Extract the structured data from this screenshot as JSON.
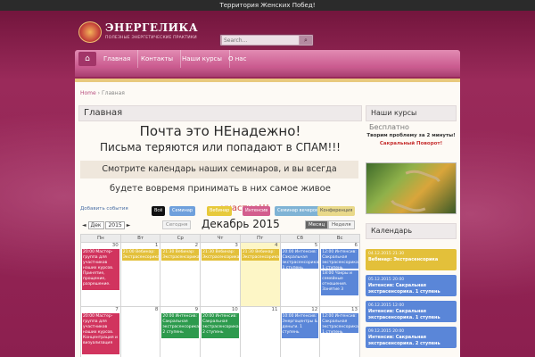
{
  "topbar": {
    "text": "Территория Женских Побед!"
  },
  "logo": {
    "title": "ЭНЕРГЕЛИКА",
    "subtitle": "ПОЛЕЗНЫЕ ЭНЕРГЕТИЧЕСКИЕ ПРАКТИКИ"
  },
  "search": {
    "placeholder": "Search..."
  },
  "nav": {
    "home_icon": "home-icon",
    "items": [
      "Главная",
      "Контакты",
      "Наши курсы",
      "О нас"
    ]
  },
  "breadcrumb": {
    "home": "Home",
    "current": "Главная"
  },
  "main": {
    "title": "Главная",
    "line1": "Почта это НЕнадежно!",
    "line2": "Письма теряются или попадают в СПАМ!!!",
    "promo1": "Смотрите календарь наших семинаров, и вы всегда",
    "promo2": "будете вовремя принимать в них самое живое",
    "promo3": "участие!!!"
  },
  "calendar": {
    "add_event": "Добавить события",
    "filters": [
      {
        "label": "Всё",
        "color": "#111111"
      },
      {
        "label": "Семинар",
        "color": "#6fa0dc"
      },
      {
        "label": "Вебинар",
        "color": "#e7c93a"
      },
      {
        "label": "Интенсив",
        "color": "#d35d8d"
      },
      {
        "label": "Семинар вечером",
        "color": "#7fb3d5"
      },
      {
        "label": "Конференция",
        "color": "#e9d98a"
      }
    ],
    "month_title": "Декабрь 2015",
    "prev": "◄",
    "next": "►",
    "month_select": "Дек",
    "year_select": "2015",
    "today": "Сегодня",
    "views": [
      "Месяц",
      "Неделя"
    ],
    "weekdays": [
      "Пн",
      "Вт",
      "Ср",
      "Чт",
      "Пт",
      "Сб",
      "Вс"
    ],
    "week1_days": [
      "30",
      "1",
      "2",
      "3",
      "4",
      "5",
      "6"
    ],
    "week2_days": [
      "7",
      "8",
      "9",
      "10",
      "11",
      "12",
      "13"
    ],
    "events": {
      "mon1": "20:00 Мастер-группа для участников наших курсов. Принятие, прощение, разрешение.",
      "tue1": "21:00 Вебинар: Экстрасенсорика",
      "wed1": "21:30 Вебинар: Экстрасенсорика",
      "thu1": "21:30 Вебинар: Экстрасенсорика",
      "fri1": "21:30 Вебинар: Экстрасенсорика",
      "sat1": "20:00 Интенсив: Сакральная экстрасенсорика. 1 ступень",
      "sun1a": "12:00 Интенсив: Сакральная экстрасенсорика. 1 ступень",
      "sun1b": "18:00 Чакры и семейные отношения. Занятие 3",
      "mon2": "20:00 Мастер-группа для участников наших курсов. Концентрация и визуализация",
      "wed2": "20:00 Интенсив: Сакральная экстрасенсорика. 2 ступень",
      "thu2": "20:00 Интенсив: Сакральная экстрасенсорика. 2 ступень",
      "sat2": "10:00 Интенсив: Энергоцентры & деньги. 1 ступень",
      "sun2": "12:00 Интенсив: Сакральная экстрасенсорика. 1 ступень"
    }
  },
  "sidebar": {
    "courses_title": "Наши курсы",
    "behind_text": "Бесплатно",
    "course_line1": "Творим проблему за 2 минуты!",
    "course_line2": "Сакральный Поворот!",
    "calendar_title": "Календарь",
    "events": [
      {
        "date": "04.12.2015 21:30",
        "name": "Вебинар: Экстрасенсорика",
        "color": "#e3c03a"
      },
      {
        "date": "05.12.2015 20:00",
        "name": "Интенсив: Сакральная экстрасенсорика. 1 ступень",
        "color": "#5a86d8"
      },
      {
        "date": "06.12.2015 12:00",
        "name": "Интенсив: Сакральная экстрасенсорика. 1 ступень",
        "color": "#5a86d8"
      },
      {
        "date": "09.12.2015 20:00",
        "name": "Интенсив: Сакральная экстрасенсорика. 2 ступень",
        "color": "#5a86d8"
      }
    ]
  },
  "colors": {
    "background": "#8c1f4f",
    "nav": "#d16a99",
    "webinar": "#e3c03a",
    "intensive_red": "#d1345e",
    "intensive_green": "#2d9a4d",
    "intensive_blue": "#5a86d8"
  }
}
